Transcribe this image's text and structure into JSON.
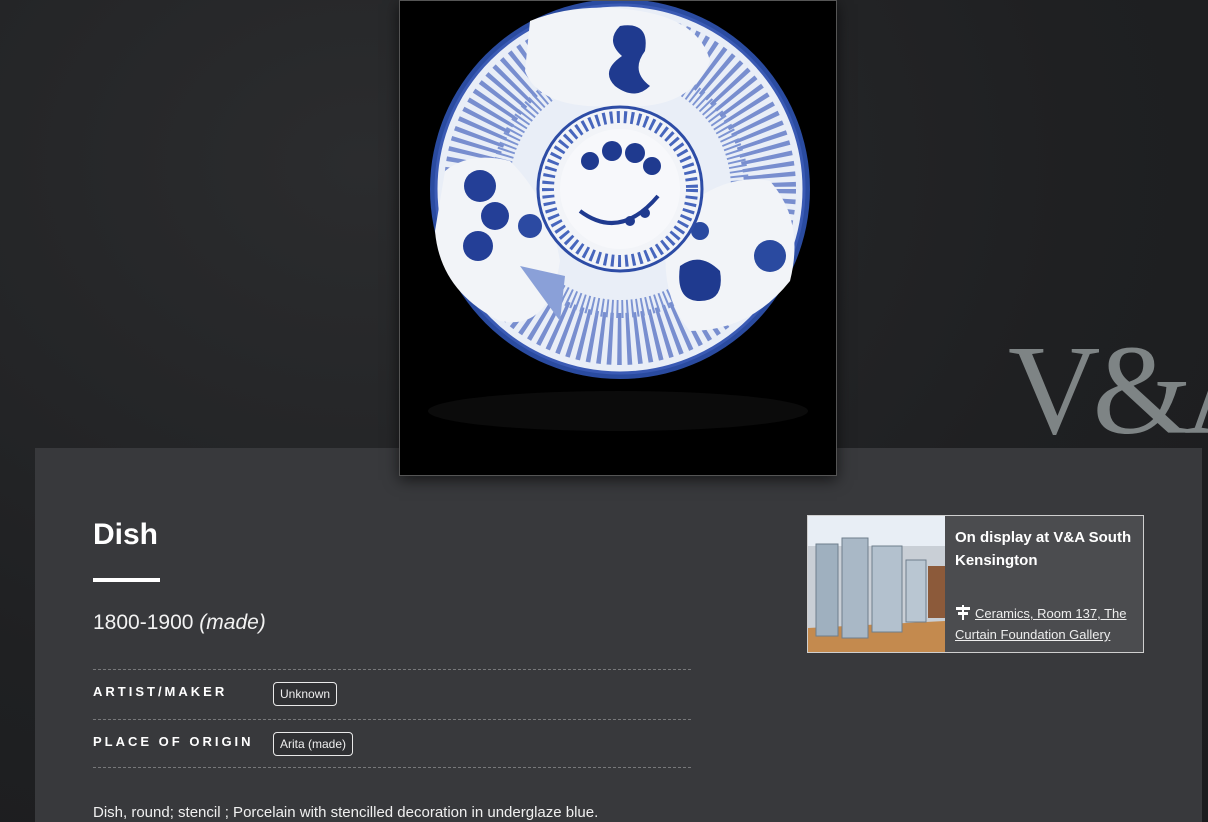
{
  "brand": {
    "logo_text": "V&A"
  },
  "object": {
    "title": "Dish",
    "date": "1800-1900",
    "date_qualifier": "(made)",
    "details": [
      {
        "label": "ARTIST/MAKER",
        "value": "Unknown"
      },
      {
        "label": "PLACE OF ORIGIN",
        "value": "Arita (made)"
      }
    ],
    "description": "Dish, round; stencil ; Porcelain with stencilled decoration in underglaze blue."
  },
  "display": {
    "heading": "On display at V&A South Kensington",
    "location": "Ceramics, Room 137, The Curtain Foundation Gallery",
    "icon": "signpost-icon"
  },
  "colors": {
    "background": "#1f2022",
    "panel": "#38393c",
    "card": "#4b4c4f",
    "logo": "#7e8485",
    "porcelain_blue": "#1f3a8f"
  }
}
